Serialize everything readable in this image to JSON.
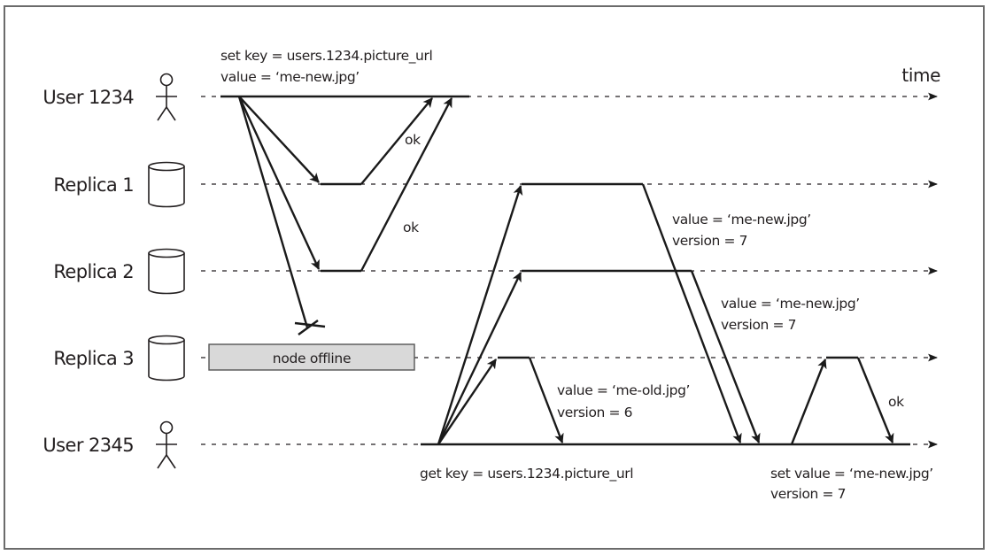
{
  "diagram": {
    "title": "",
    "time_label": "time",
    "participants": [
      {
        "id": "user1234",
        "label": "User 1234",
        "kind": "user",
        "icon": "stick-figure-icon"
      },
      {
        "id": "replica1",
        "label": "Replica 1",
        "kind": "replica",
        "icon": "database-cylinder-icon"
      },
      {
        "id": "replica2",
        "label": "Replica 2",
        "kind": "replica",
        "icon": "database-cylinder-icon"
      },
      {
        "id": "replica3",
        "label": "Replica 3",
        "kind": "replica",
        "icon": "database-cylinder-icon"
      },
      {
        "id": "user2345",
        "label": "User 2345",
        "kind": "user",
        "icon": "stick-figure-icon"
      }
    ],
    "offline_label": "node offline",
    "annotations": {
      "write_request": [
        "set key = users.1234.picture_url",
        "value = ‘me-new.jpg’"
      ],
      "ok_replica1": "ok",
      "ok_replica2": "ok",
      "replica1_response": [
        "value = ‘me-new.jpg’",
        "version = 7"
      ],
      "replica2_response": [
        "value = ‘me-new.jpg’",
        "version = 7"
      ],
      "replica3_response": [
        "value = ‘me-old.jpg’",
        "version = 6"
      ],
      "read_request": "get key = users.1234.picture_url",
      "read_repair": [
        "set value = ‘me-new.jpg’",
        "version = 7"
      ],
      "ok_repair": "ok"
    },
    "messages": [
      {
        "from": "user1234",
        "to": "replica1",
        "kind": "write",
        "result": "delivered"
      },
      {
        "from": "user1234",
        "to": "replica2",
        "kind": "write",
        "result": "delivered"
      },
      {
        "from": "user1234",
        "to": "replica3",
        "kind": "write",
        "result": "lost"
      },
      {
        "from": "replica1",
        "to": "user1234",
        "kind": "ack",
        "label": "ok"
      },
      {
        "from": "replica2",
        "to": "user1234",
        "kind": "ack",
        "label": "ok"
      },
      {
        "from": "user2345",
        "to": "replica1",
        "kind": "read"
      },
      {
        "from": "user2345",
        "to": "replica2",
        "kind": "read"
      },
      {
        "from": "user2345",
        "to": "replica3",
        "kind": "read"
      },
      {
        "from": "replica3",
        "to": "user2345",
        "kind": "response",
        "value": "me-old.jpg",
        "version": 6
      },
      {
        "from": "replica1",
        "to": "user2345",
        "kind": "response",
        "value": "me-new.jpg",
        "version": 7
      },
      {
        "from": "replica2",
        "to": "user2345",
        "kind": "response",
        "value": "me-new.jpg",
        "version": 7
      },
      {
        "from": "user2345",
        "to": "replica3",
        "kind": "read-repair",
        "value": "me-new.jpg",
        "version": 7
      },
      {
        "from": "replica3",
        "to": "user2345",
        "kind": "ack",
        "label": "ok"
      }
    ]
  }
}
